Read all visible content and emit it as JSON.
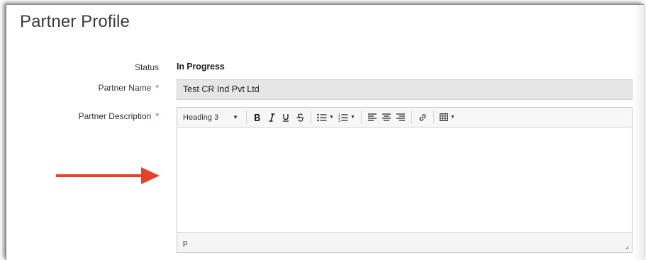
{
  "page": {
    "title": "Partner Profile"
  },
  "form": {
    "status_label": "Status",
    "status_value": "In Progress",
    "name_label": "Partner Name",
    "name_value": "Test CR Ind Pvt Ltd",
    "description_label": "Partner Description",
    "required_mark": "*"
  },
  "editor": {
    "block_format": "Heading 3",
    "path_label": "p",
    "body_text": ""
  },
  "colors": {
    "annotation_arrow": "#e8402a",
    "required": "#d9423a"
  }
}
